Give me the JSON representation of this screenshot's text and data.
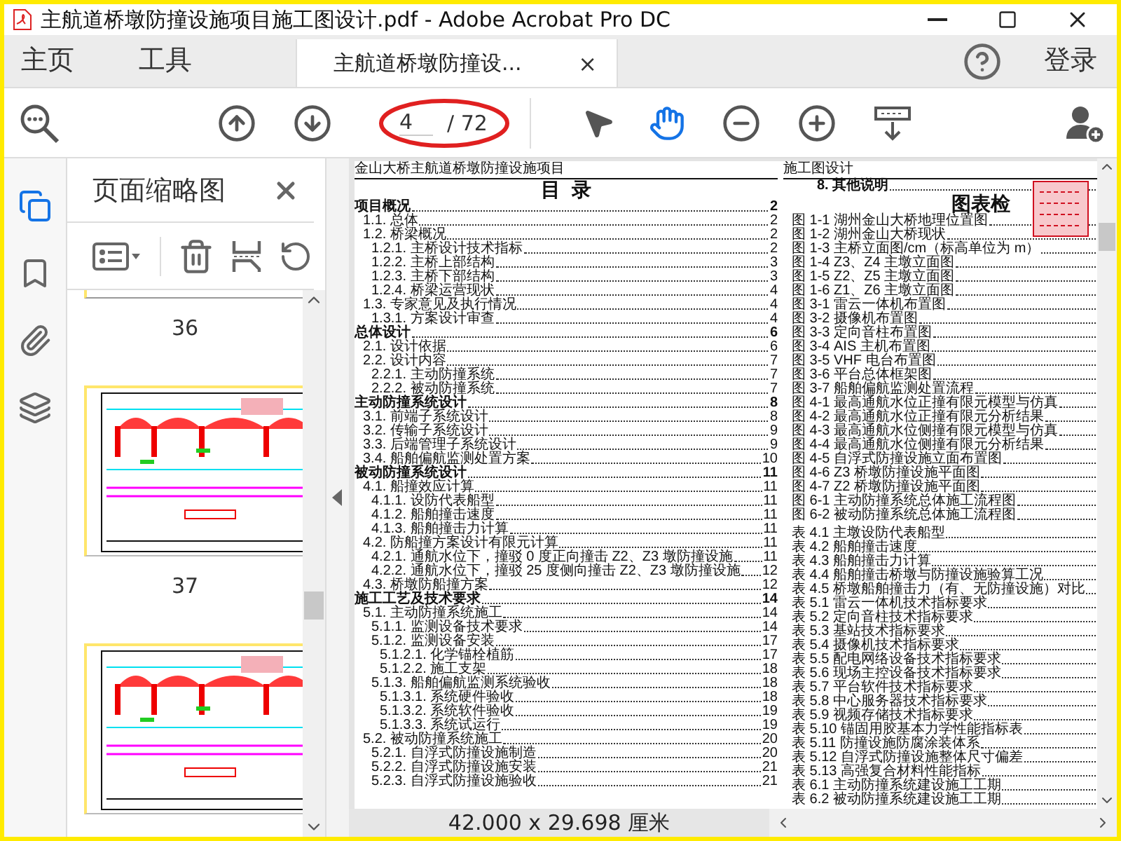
{
  "window": {
    "title": "主航道桥墩防撞设施项目施工图设计.pdf - Adobe Acrobat Pro DC"
  },
  "nav_tabs": [
    {
      "label": "主页",
      "selected": false
    },
    {
      "label": "工具",
      "selected": false
    }
  ],
  "document_tab": {
    "label": "主航道桥墩防撞设...",
    "close": "×",
    "selected": true
  },
  "account": {
    "label": "登录"
  },
  "toolbar": {
    "page_current": "4",
    "page_total": "/ 72",
    "tools": [
      {
        "kind": "select",
        "selected": false
      },
      {
        "kind": "hand",
        "selected": true
      }
    ]
  },
  "side_rail": [
    {
      "kind": "pages",
      "selected": true
    },
    {
      "kind": "bookmarks",
      "selected": false
    },
    {
      "kind": "attachments",
      "selected": false
    },
    {
      "kind": "layers",
      "selected": false
    }
  ],
  "thumbnails_panel": {
    "title": "页面缩略图",
    "pages": [
      {
        "kind": "edge",
        "label": "36"
      },
      {
        "kind": "full",
        "label": "37"
      },
      {
        "kind": "full"
      }
    ]
  },
  "document": {
    "left_header": "金山大桥主航道桥墩防撞设施项目",
    "toc_title": "目  录",
    "toc": [
      {
        "title": "项目概况",
        "page": "2",
        "children": [
          {
            "title": "1.1. 总体",
            "page": "2"
          },
          {
            "title": "1.2. 桥梁概况",
            "page": "2",
            "children": [
              {
                "title": "1.2.1. 主桥设计技术指标",
                "page": "2"
              },
              {
                "title": "1.2.2. 主桥上部结构",
                "page": "3"
              },
              {
                "title": "1.2.3. 主桥下部结构",
                "page": "3"
              },
              {
                "title": "1.2.4. 桥梁运营现状",
                "page": "4"
              }
            ]
          },
          {
            "title": "1.3. 专家意见及执行情况",
            "page": "4",
            "children": [
              {
                "title": "1.3.1. 方案设计审查",
                "page": "4"
              }
            ]
          }
        ]
      },
      {
        "title": "总体设计",
        "page": "6",
        "children": [
          {
            "title": "2.1. 设计依据",
            "page": "6"
          },
          {
            "title": "2.2. 设计内容",
            "page": "7",
            "children": [
              {
                "title": "2.2.1. 主动防撞系统",
                "page": "7"
              },
              {
                "title": "2.2.2. 被动防撞系统",
                "page": "7"
              }
            ]
          }
        ]
      },
      {
        "title": "主动防撞系统设计",
        "page": "8",
        "children": [
          {
            "title": "3.1. 前端子系统设计",
            "page": "8"
          },
          {
            "title": "3.2. 传输子系统设计",
            "page": "9"
          },
          {
            "title": "3.3. 后端管理子系统设计",
            "page": "9"
          },
          {
            "title": "3.4. 船舶偏航监测处置方案",
            "page": "10"
          }
        ]
      },
      {
        "title": "被动防撞系统设计",
        "page": "11",
        "children": [
          {
            "title": "4.1. 船撞效应计算",
            "page": "11",
            "children": [
              {
                "title": "4.1.1. 设防代表船型",
                "page": "11"
              },
              {
                "title": "4.1.2. 船舶撞击速度",
                "page": "11"
              },
              {
                "title": "4.1.3. 船舶撞击力计算",
                "page": "11"
              }
            ]
          },
          {
            "title": "4.2. 防船撞方案设计有限元计算",
            "page": "11",
            "children": [
              {
                "title": "4.2.1. 通航水位下，撞驳 0 度正向撞击 Z2、Z3 墩防撞设施",
                "page": "11"
              },
              {
                "title": "4.2.2. 通航水位下，撞驳 25 度侧向撞击 Z2、Z3 墩防撞设施",
                "page": "12"
              }
            ]
          },
          {
            "title": "4.3. 桥墩防船撞方案",
            "page": "12"
          }
        ]
      },
      {
        "title": "施工工艺及技术要求",
        "page": "14",
        "children": [
          {
            "title": "5.1. 主动防撞系统施工",
            "page": "14",
            "children": [
              {
                "title": "5.1.1. 监测设备技术要求",
                "page": "14"
              },
              {
                "title": "5.1.2. 监测设备安装",
                "page": "17",
                "children": [
                  {
                    "title": "5.1.2.1. 化学锚栓植筋",
                    "page": "17"
                  },
                  {
                    "title": "5.1.2.2. 施工支架",
                    "page": "18"
                  }
                ]
              },
              {
                "title": "5.1.3. 船舶偏航监测系统验收",
                "page": "18",
                "children": [
                  {
                    "title": "5.1.3.1. 系统硬件验收",
                    "page": "18"
                  },
                  {
                    "title": "5.1.3.2. 系统软件验收",
                    "page": "19"
                  },
                  {
                    "title": "5.1.3.3. 系统试运行",
                    "page": "19"
                  }
                ]
              }
            ]
          },
          {
            "title": "5.2. 被动防撞系统施工",
            "page": "20",
            "children": [
              {
                "title": "5.2.1. 自浮式防撞设施制造",
                "page": "20"
              },
              {
                "title": "5.2.2. 自浮式防撞设施安装",
                "page": "21"
              },
              {
                "title": "5.2.3. 自浮式防撞设施验收",
                "page": "21"
              }
            ]
          }
        ]
      }
    ],
    "right_header": "施工图设计",
    "other_entry": "8. 其他说明",
    "list_title": "图表检",
    "figures": [
      "图 1-1 湖州金山大桥地理位置图",
      "图 1-2 湖州金山大桥现状",
      "图 1-3 主桥立面图/cm（标高单位为 m）",
      "图 1-4 Z3、Z4 主墩立面图",
      "图 1-5 Z2、Z5 主墩立面图",
      "图 1-6 Z1、Z6 主墩立面图",
      "图 3-1 雷云一体机布置图",
      "图 3-2 摄像机布置图",
      "图 3-3 定向音柱布置图",
      "图 3-4 AIS 主机布置图",
      "图 3-5 VHF 电台布置图",
      "图 3-6 平台总体框架图",
      "图 3-7 船舶偏航监测处置流程",
      "图 4-1 最高通航水位正撞有限元模型与仿真",
      "图 4-2 最高通航水位正撞有限元分析结果",
      "图 4-3 最高通航水位侧撞有限元模型与仿真",
      "图 4-4 最高通航水位侧撞有限元分析结果",
      "图 4-5 自浮式防撞设施立面布置图",
      "图 4-6 Z3 桥墩防撞设施平面图",
      "图 4-7 Z2 桥墩防撞设施平面图",
      "图 6-1 主动防撞系统总体施工流程图",
      "图 6-2 被动防撞系统总体施工流程图"
    ],
    "tables": [
      "表 4.1 主墩设防代表船型",
      "表 4.2 船舶撞击速度",
      "表 4.3 船舶撞击力计算",
      "表 4.4 船舶撞击桥墩与防撞设施验算工况",
      "表 4.5 桥墩船舶撞击力（有、无防撞设施）对比",
      "表 5.1 雷云一体机技术指标要求",
      "表 5.2 定向音柱技术指标要求",
      "表 5.3 基站技术指标要求",
      "表 5.4 摄像机技术指标要求",
      "表 5.5 配电网络设备技术指标要求",
      "表 5.6 现场主控设备技术指标要求",
      "表 5.7 平台软件技术指标要求",
      "表 5.8 中心服务器技术指标要求",
      "表 5.9 视频存储技术指标要求",
      "表 5.10 锚固用胶基本力学性能指标表",
      "表 5.11 防撞设施防腐涂装体系",
      "表 5.12 自浮式防撞设施整体尺寸偏差",
      "表 5.13 高强复合材料性能指标",
      "表 6.1 主动防撞系统建设施工工期",
      "表 6.2 被动防撞系统建设施工工期"
    ]
  },
  "status_bar": {
    "page_size": "42.000 x 29.698 厘米"
  }
}
